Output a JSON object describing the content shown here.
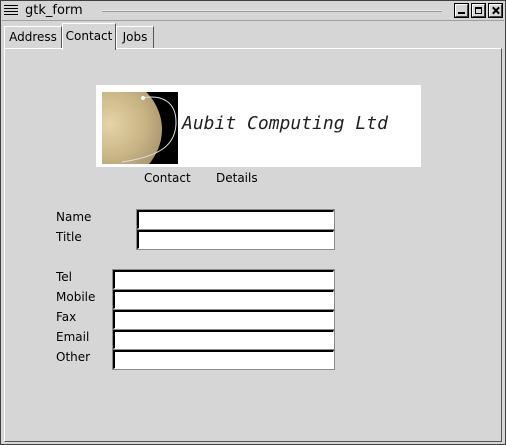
{
  "window": {
    "title": "gtk_form"
  },
  "tabs": [
    {
      "label": "Address",
      "active": false
    },
    {
      "label": "Contact",
      "active": true
    },
    {
      "label": "Jobs",
      "active": false
    }
  ],
  "banner": {
    "company": "Aubit Computing Ltd"
  },
  "section": {
    "word1": "Contact",
    "word2": "Details"
  },
  "fields": {
    "name": {
      "label": "Name",
      "value": ""
    },
    "title": {
      "label": "Title",
      "value": ""
    },
    "tel": {
      "label": "Tel",
      "value": ""
    },
    "mobile": {
      "label": "Mobile",
      "value": ""
    },
    "fax": {
      "label": "Fax",
      "value": ""
    },
    "email": {
      "label": "Email",
      "value": ""
    },
    "other": {
      "label": "Other",
      "value": ""
    }
  }
}
